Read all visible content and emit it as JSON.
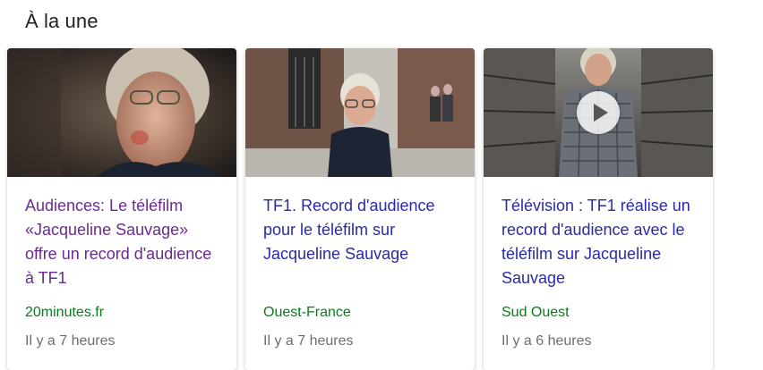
{
  "section": {
    "title": "À la une"
  },
  "cards": [
    {
      "headline": "Audiences: Le téléfilm «Jacqueline Sauvage» offre un record d'audience à TF1",
      "source": "20minutes.fr",
      "time": "Il y a 7 heures",
      "visited": true,
      "has_video": false
    },
    {
      "headline": "TF1. Record d'audience pour le téléfilm sur Jacqueline Sauvage",
      "source": "Ouest-France",
      "time": "Il y a 7 heures",
      "visited": false,
      "has_video": false
    },
    {
      "headline": "Télévision : TF1 réalise un record d'audience avec le téléfilm sur Jacqueline Sauvage",
      "source": "Sud Ouest",
      "time": "Il y a 6 heures",
      "visited": false,
      "has_video": true
    }
  ],
  "colors": {
    "visited_link": "#6b2a8f",
    "link": "#2a2aa6",
    "source": "#0b7a1e",
    "time": "#6d6d6d"
  }
}
